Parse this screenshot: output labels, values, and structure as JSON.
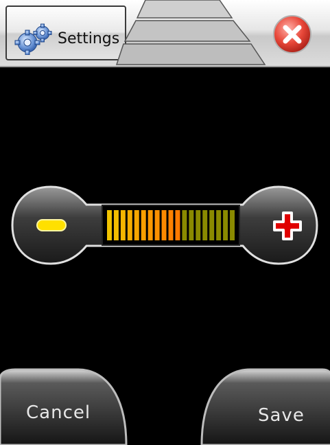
{
  "titlebar": {
    "title": "Settings",
    "icon": "gears-icon",
    "close_icon": "close-icon"
  },
  "volume": {
    "minus_icon": "minus-icon",
    "plus_icon": "plus-icon",
    "level_segments": 19,
    "level_fraction": 0.58,
    "colors": {
      "low": "#f2c400",
      "mid": "#ff7a00",
      "high_dim": "#8a8a00",
      "minus": "#ffe000",
      "plus": "#e00000"
    }
  },
  "buttons": {
    "cancel_label": "Cancel",
    "save_label": "Save"
  }
}
